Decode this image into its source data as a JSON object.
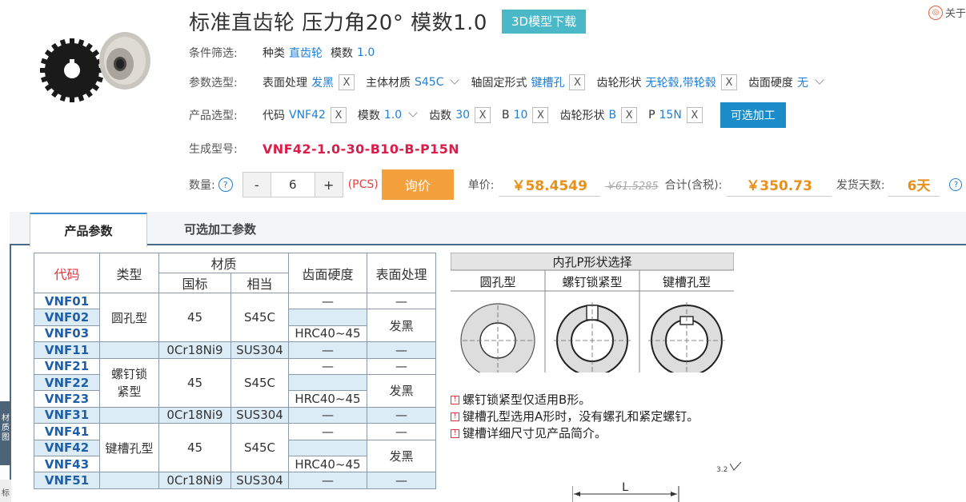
{
  "header": {
    "title": "标准直齿轮 压力角20° 模数1.0",
    "download_label": "3D模型下载",
    "about_label": "关于"
  },
  "conditions": {
    "label": "条件筛选:",
    "items": [
      {
        "key": "种类",
        "value": "直齿轮"
      },
      {
        "key": "模数",
        "value": "1.0"
      }
    ]
  },
  "params": {
    "label": "参数选型:",
    "surface": {
      "key": "表面处理",
      "value": "发黑"
    },
    "material": {
      "key": "主体材质",
      "value": "S45C"
    },
    "shaft": {
      "key": "轴固定形式",
      "value": "键槽孔"
    },
    "shape": {
      "key": "齿轮形状",
      "value": "无轮毂,带轮毂"
    },
    "hardness": {
      "key": "齿面硬度",
      "value": "无"
    }
  },
  "product": {
    "label": "产品选型:",
    "code": {
      "key": "代码",
      "value": "VNF42"
    },
    "module": {
      "key": "模数",
      "value": "1.0"
    },
    "teeth": {
      "key": "齿数",
      "value": "30"
    },
    "b": {
      "key": "B",
      "value": "10"
    },
    "shape": {
      "key": "齿轮形状",
      "value": "B"
    },
    "p": {
      "key": "P",
      "value": "15N"
    },
    "optional_btn": "可选加工"
  },
  "model": {
    "label": "生成型号:",
    "value": "VNF42-1.0-30-B10-B-P15N"
  },
  "order": {
    "qty_label": "数量:",
    "qty_help": "?",
    "minus": "-",
    "qty": "6",
    "plus": "+",
    "unit": "(PCS)",
    "inquire": "询价",
    "unit_price_label": "单价:",
    "unit_price": "￥58.4549",
    "orig_price": "￥61.5285",
    "total_label": "合计(含税):",
    "total": "￥350.73",
    "ship_label": "发货天数:",
    "ship_days": "6天"
  },
  "tabs": [
    {
      "label": "产品参数"
    },
    {
      "label": "可选加工参数"
    }
  ],
  "side": {
    "tab1": "材质图",
    "tab2": "标"
  },
  "spec_table": {
    "headers": {
      "code": "代码",
      "type": "类型",
      "material": "材质",
      "std": "国标",
      "eq": "相当",
      "hardness": "齿面硬度",
      "surface": "表面处理"
    },
    "dash": "—",
    "rows": [
      {
        "code": "VNF01"
      },
      {
        "code": "VNF02"
      },
      {
        "code": "VNF03"
      },
      {
        "code": "VNF11"
      },
      {
        "code": "VNF21"
      },
      {
        "code": "VNF22"
      },
      {
        "code": "VNF23"
      },
      {
        "code": "VNF31"
      },
      {
        "code": "VNF41"
      },
      {
        "code": "VNF42"
      },
      {
        "code": "VNF43"
      },
      {
        "code": "VNF51"
      }
    ],
    "types": [
      "圆孔型",
      "螺钉锁紧型",
      "键槽孔型"
    ],
    "mat45": "45",
    "s45c": "S45C",
    "mat_sus": "0Cr18Ni9",
    "sus304": "SUS304",
    "hrc": "HRC40~45",
    "black": "发黑"
  },
  "shape_panel": {
    "title": "内孔P形状选择",
    "cols": [
      "圆孔型",
      "螺钉锁紧型",
      "键槽孔型"
    ]
  },
  "notes": [
    "螺钉锁紧型仅适用B形。",
    "键槽孔型选用A形时，没有螺孔和紧定螺钉。",
    "键槽详细尺寸见产品简介。"
  ],
  "roughness": "3.2",
  "dim_label": "L",
  "colors": {
    "accent": "#1b8cc7",
    "model": "#d81e4b",
    "price": "#e8901b",
    "inquire": "#f4a03c",
    "download": "#4bb8c8"
  }
}
